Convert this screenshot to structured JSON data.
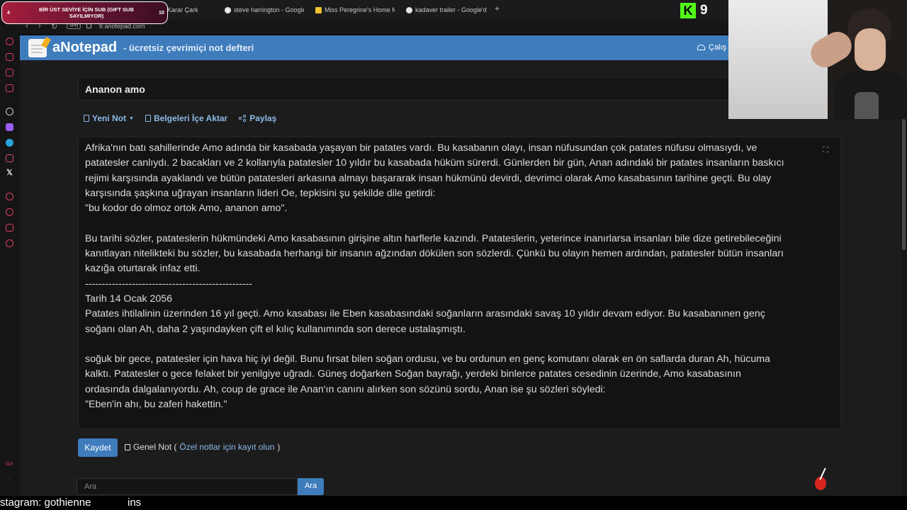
{
  "alert": {
    "left": "4",
    "text": "BİR ÜST SEVİYE İÇİN SUB (GIFT SUB SAYILMIYOR)",
    "right": "10"
  },
  "tabs": [
    {
      "label": "Çark Çevirme - Karar Çark",
      "icon": "spinner-icon"
    },
    {
      "label": "steve harrington - Google",
      "icon": "google-icon"
    },
    {
      "label": "Miss Peregrine's Home fo",
      "icon": "bookmark-icon"
    },
    {
      "label": "kadaver trailer - Google'd",
      "icon": "google-icon"
    }
  ],
  "kick": {
    "count": "9",
    "color": "#53fc18"
  },
  "address": {
    "url": "tr.anotepad.com",
    "vpn": "VPN"
  },
  "site": {
    "brand": "aNotepad",
    "tagline": "- ücretsiz çevrimiçi not defteri",
    "work_label": "Çalış",
    "header_color": "#3e7cbc"
  },
  "note": {
    "title": "Ananon amo",
    "toolbar": {
      "new_note": "Yeni Not",
      "import": "Belgeleri İçe Aktar",
      "share": "Paylaş"
    },
    "body": "Afrika'nın batı sahillerinde Amo adında bir kasabada yaşayan bir patates vardı. Bu kasabanın olayı, insan nüfusundan çok patates nüfusu olmasıydı, ve\npatatesler canlıydı. 2 bacakları ve 2 kollarıyla patatesler 10 yıldır bu kasabada hüküm sürerdi. Günlerden bir gün, Anan adındaki bir patates insanların baskıcı\nrejimi karşısında ayaklandı ve bütün patatesleri arkasına almayı başararak insan hükmünü devirdi, devrimci olarak Amo kasabasının tarihine geçti. Bu olay\nkarşısında şaşkına uğrayan insanların lideri Oe, tepkisini şu şekilde dile getirdi:\n\"bu kodor do olmoz ortok Amo, ananon amo\".\n\nBu tarihi sözler, patateslerin hükmündeki Amo kasabasının girişine altın harflerle kazındı. Patateslerin, yeterince inanırlarsa insanları bile dize getirebileceğini\nkanıtlayan nitelikteki bu sözler, bu kasabada herhangi bir insanın ağzından dökülen son sözlerdi. Çünkü bu olayın hemen ardından, patatesler bütün insanları\nkazığa oturtarak infaz etti.\n--------------------------------------------------\nTarih 14 Ocak 2056\nPatates ihtilalinin üzerinden 16 yıl geçti. Amo kasabası ile Eben kasabasındaki soğanların arasındaki savaş 10 yıldır devam ediyor. Bu kasabanınen genç\nsoğanı olan Ah, daha 2 yaşındayken çift el kılıç kullanımında son derece ustalaşmıştı.\n\nsoğuk bir gece, patatesler için hava hiç iyi değil. Bunu fırsat bilen soğan ordusu, ve bu ordunun en genç komutanı olarak en ön saflarda duran Ah, hücuma\nkalktı. Patatesler o gece felaket bir yenilgiye uğradı. Güneş doğarken Soğan bayrağı, yerdeki binlerce patates cesedinin üzerinde, Amo kasabasının\nordasında dalgalanıyordu. Ah, coup de grace ile Anan'ın canını alırken son sözünü sordu, Anan ise şu sözleri söyledi:\n\"Eben'in ahı, bu zaferi hakettin.\""
  },
  "footer": {
    "save": "Kaydet",
    "public_note": "Genel Not (",
    "register_link": "Özel notlar için kayıt olun",
    "close_paren": ")",
    "search_placeholder": "Ara",
    "search_button": "Ara"
  },
  "ticker": {
    "left": "stagram: gothienne",
    "right": "ins"
  }
}
